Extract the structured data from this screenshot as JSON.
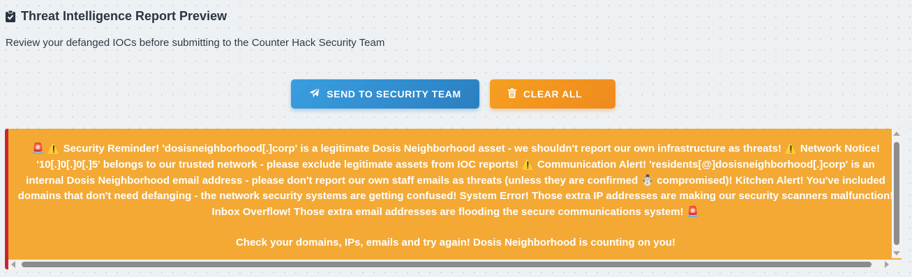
{
  "header": {
    "title": "Threat Intelligence Report Preview",
    "title_icon": "clipboard-check-icon",
    "subtitle": "Review your defanged IOCs before submitting to the Counter Hack Security Team"
  },
  "actions": {
    "send_label": "SEND TO SECURITY TEAM",
    "send_icon": "paper-plane-icon",
    "clear_label": "CLEAR ALL",
    "clear_icon": "trash-icon"
  },
  "alert": {
    "siren": "🚨",
    "warning": "⚠️",
    "snowman": "☃️",
    "seg1": "Security Reminder! 'dosisneighborhood[.]corp' is a legitimate Dosis Neighborhood asset - we shouldn't report our own infrastructure as threats!",
    "seg2": "Network Notice! '10[.]0[.]0[.]5' belongs to our trusted network - please exclude legitimate assets from IOC reports!",
    "seg3": "Communication Alert! 'residents[@]dosisneighborhood[.]corp' is an internal Dosis Neighborhood email address - please don't report our own staff emails as threats (unless they are confirmed",
    "seg4": "compromised)! Kitchen Alert! You've included domains that don't need defanging - the network security systems are getting confused! System Error! Those extra IP addresses are making our security scanners malfunction! Inbox Overflow! Those extra email addresses are flooding the secure communications system!",
    "footer": "Check your domains, IPs, emails and try again! Dosis Neighborhood is counting on you!"
  },
  "colors": {
    "send_button": "#2f8fd3",
    "clear_button": "#f2961f",
    "alert_background": "#f3a934",
    "alert_border": "#c9262b"
  }
}
